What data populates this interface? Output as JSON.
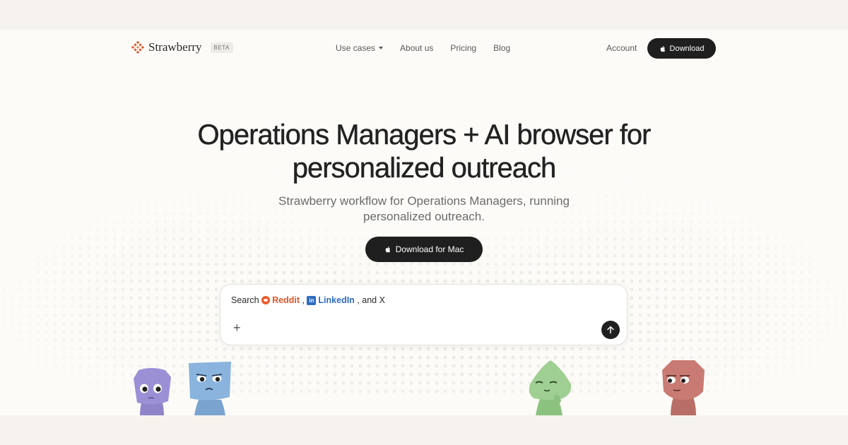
{
  "brand": {
    "name": "Strawberry",
    "badge": "BETA",
    "accent": "#e0562b"
  },
  "nav": {
    "links": [
      "Use cases",
      "About us",
      "Pricing",
      "Blog"
    ],
    "account": "Account",
    "download": "Download",
    "download_icon": "apple-icon"
  },
  "hero": {
    "title_line1": "Operations Managers + AI browser for",
    "title_line2": "personalized outreach",
    "subtitle_line1": "Strawberry workflow for Operations Managers, running",
    "subtitle_line2": "personalized outreach.",
    "cta": "Download for Mac"
  },
  "prompt": {
    "search_label": "Search",
    "reddit": "Reddit",
    "comma": " ,",
    "linkedin": "LinkedIn",
    "tail": " , and X",
    "add_icon": "plus-icon",
    "send_icon": "arrow-up-icon"
  },
  "colors": {
    "dark": "#1f1f1f",
    "reddit": "#e0562b",
    "linkedin": "#2d6cc0",
    "purple_char": "#9b8fd6",
    "blue_char": "#8ab4de",
    "green_char": "#9fcf92",
    "red_char": "#c97a72"
  }
}
